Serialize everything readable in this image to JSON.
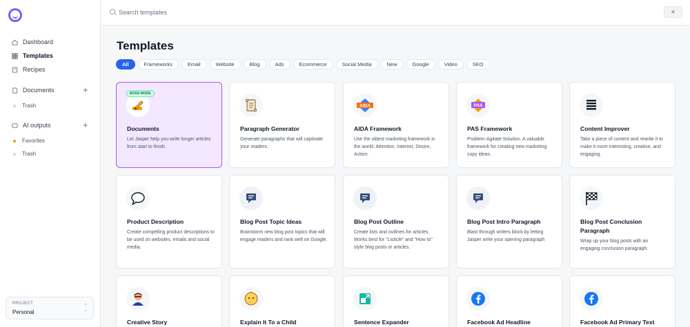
{
  "sidebar": {
    "items": [
      {
        "label": "Dashboard",
        "icon": "home-icon"
      },
      {
        "label": "Templates",
        "icon": "grid-icon"
      },
      {
        "label": "Recipes",
        "icon": "book-icon"
      }
    ],
    "documents": {
      "label": "Documents",
      "sub": [
        "Trash"
      ]
    },
    "ai_outputs": {
      "label": "AI outputs",
      "sub": [
        "Favorites",
        "Trash"
      ]
    },
    "project": {
      "label": "PROJECT",
      "value": "Personal"
    }
  },
  "search": {
    "placeholder": "Search templates"
  },
  "main": {
    "title": "Templates",
    "filters": [
      "All",
      "Frameworks",
      "Email",
      "Website",
      "Blog",
      "Ads",
      "Ecommerce",
      "Social Media",
      "New",
      "Google",
      "Video",
      "SEO"
    ],
    "active_filter": "All",
    "cards": [
      {
        "title": "Documents",
        "desc": "Let Jasper help you write longer articles from start to finish.",
        "badge": "BOSS MODE",
        "icon": "pencil-writing-icon"
      },
      {
        "title": "Paragraph Generator",
        "desc": "Generate paragraphs that will captivate your readers.",
        "icon": "scroll-icon"
      },
      {
        "title": "AIDA Framework",
        "desc": "Use the oldest marketing framework in the world. Attention, Interest, Desire, Action.",
        "icon": "aida-icon",
        "icon_text": "AIDA"
      },
      {
        "title": "PAS Framework",
        "desc": "Problem-Agitate-Solution. A valuable framework for creating new marketing copy ideas.",
        "icon": "pas-icon",
        "icon_text": "PAS"
      },
      {
        "title": "Content Improver",
        "desc": "Take a piece of content and rewrite it to make it more interesting, creative, and engaging.",
        "icon": "lines-icon"
      },
      {
        "title": "Product Description",
        "desc": "Create compelling product descriptions to be used on websites, emails and social media.",
        "icon": "speech-bubble-icon"
      },
      {
        "title": "Blog Post Topic Ideas",
        "desc": "Brainstorm new blog post topics that will engage readers and rank well on Google.",
        "icon": "blog-chat-icon"
      },
      {
        "title": "Blog Post Outline",
        "desc": "Create lists and outlines for articles. Works best for \"Listicle\" and \"How to\" style blog posts or articles.",
        "icon": "blog-chat-icon"
      },
      {
        "title": "Blog Post Intro Paragraph",
        "desc": "Blast through writers block by letting Jasper write your opening paragraph",
        "icon": "blog-chat-icon"
      },
      {
        "title": "Blog Post Conclusion Paragraph",
        "desc": "Wrap up your blog posts with an engaging conclusion paragraph.",
        "icon": "checkered-flag-icon"
      },
      {
        "title": "Creative Story",
        "desc": "",
        "icon": "person-icon"
      },
      {
        "title": "Explain It To a Child",
        "desc": "",
        "icon": "baby-icon"
      },
      {
        "title": "Sentence Expander",
        "desc": "",
        "icon": "expand-icon"
      },
      {
        "title": "Facebook Ad Headline",
        "desc": "",
        "icon": "facebook-icon"
      },
      {
        "title": "Facebook Ad Primary Text",
        "desc": "",
        "icon": "facebook-icon"
      }
    ]
  }
}
